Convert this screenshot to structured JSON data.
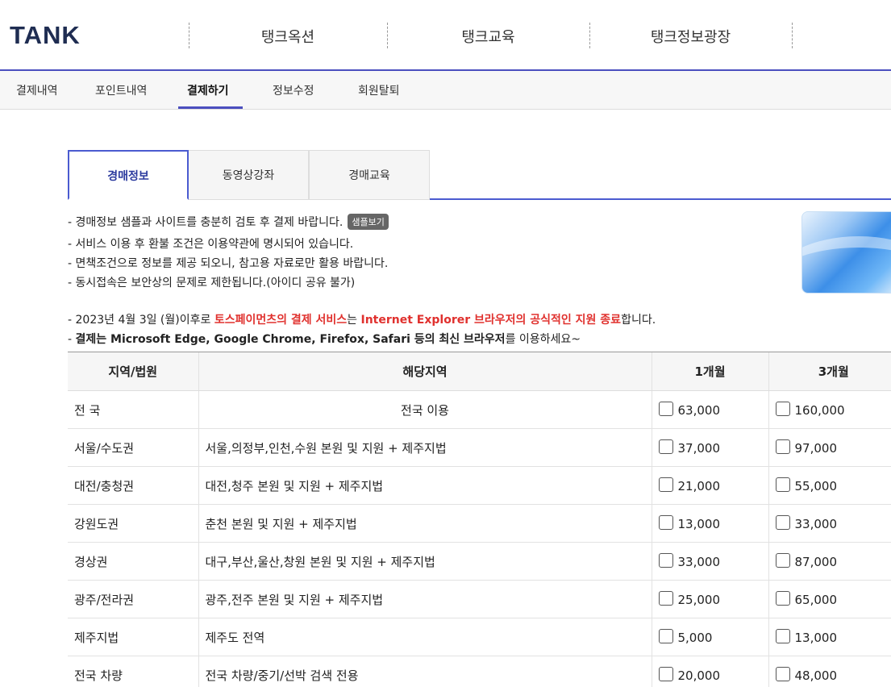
{
  "header": {
    "logo": "TANK",
    "nav": [
      "탱크옥션",
      "탱크교육",
      "탱크정보광장"
    ]
  },
  "subnav": {
    "items": [
      "결제내역",
      "포인트내역",
      "결제하기",
      "정보수정",
      "회원탈퇴"
    ],
    "active": "결제하기"
  },
  "tabs": {
    "items": [
      "경매정보",
      "동영상강좌",
      "경매교육"
    ],
    "active": "경매정보"
  },
  "notices": {
    "line1": "- 경매정보 샘플과 사이트를 충분히 검토 후 결제 바랍니다.",
    "sample_button": "샘플보기",
    "line2": "- 서비스 이용 후 환불 조건은 이용약관에 명시되어 있습니다.",
    "line3": "- 면책조건으로 정보를 제공 되오니, 참고용 자료로만 활용 바랍니다.",
    "line4": "- 동시접속은 보안상의 문제로 제한됩니다.(아이디 공유 불가)",
    "line5_a": "- 2023년 4월 3일 (월)이후로 ",
    "line5_b": "토스페이먼츠의 결제 서비스",
    "line5_c": "는 ",
    "line5_d": "Internet Explorer 브라우저의 공식적인 지원 종료",
    "line5_e": "합니다.",
    "line6_a": "- ",
    "line6_b": "결제는 Microsoft Edge, Google Chrome, Firefox, Safari 등의 최신 브라우저",
    "line6_c": "를 이용하세요~"
  },
  "table": {
    "headers": [
      "지역/법원",
      "해당지역",
      "1개월",
      "3개월"
    ],
    "rows": [
      {
        "region": "전 국",
        "area": "전국 이용",
        "m1": "63,000",
        "m3": "160,000"
      },
      {
        "region": "서울/수도권",
        "area": "서울,의정부,인천,수원 본원 및 지원 + 제주지법",
        "m1": "37,000",
        "m3": "97,000"
      },
      {
        "region": "대전/충청권",
        "area": "대전,청주 본원 및 지원 + 제주지법",
        "m1": "21,000",
        "m3": "55,000"
      },
      {
        "region": "강원도권",
        "area": "춘천 본원 및 지원 + 제주지법",
        "m1": "13,000",
        "m3": "33,000"
      },
      {
        "region": "경상권",
        "area": "대구,부산,울산,창원 본원 및 지원 + 제주지법",
        "m1": "33,000",
        "m3": "87,000"
      },
      {
        "region": "광주/전라권",
        "area": "광주,전주 본원 및 지원 + 제주지법",
        "m1": "25,000",
        "m3": "65,000"
      },
      {
        "region": "제주지법",
        "area": "제주도 전역",
        "m1": "5,000",
        "m3": "13,000"
      },
      {
        "region": "전국 차량",
        "area": "전국 차량/중기/선박 검색 전용",
        "m1": "20,000",
        "m3": "48,000"
      }
    ]
  },
  "colors": {
    "accent": "#4b4fbf",
    "tab_active": "#2b3a9e",
    "warning_red": "#e0312e"
  }
}
